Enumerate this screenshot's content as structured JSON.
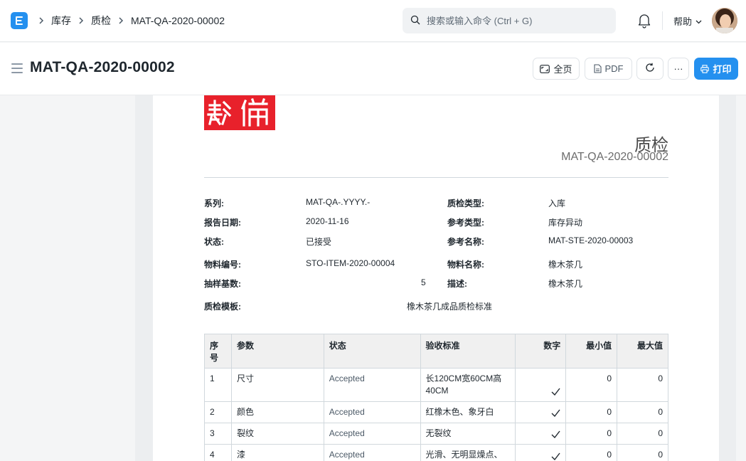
{
  "navbar": {
    "breadcrumbs": [
      "库存",
      "质检",
      "MAT-QA-2020-00002"
    ],
    "search_placeholder": "搜索或输入命令 (Ctrl + G)",
    "help_label": "帮助"
  },
  "page": {
    "title": "MAT-QA-2020-00002",
    "buttons": {
      "full_page": "全页",
      "pdf": "PDF",
      "more": "···",
      "print": "打印"
    }
  },
  "document": {
    "doctype_heading": "质检",
    "doc_name": "MAT-QA-2020-00002",
    "fields": {
      "series_label": "系列:",
      "series_value": "MAT-QA-.YYYY.-",
      "inspection_type_label": "质检类型:",
      "inspection_type_value": "入库",
      "report_date_label": "报告日期:",
      "report_date_value": "2020-11-16",
      "reference_type_label": "参考类型:",
      "reference_type_value": "库存异动",
      "status_label": "状态:",
      "status_value": "已接受",
      "reference_name_label": "参考名称:",
      "reference_name_value": "MAT-STE-2020-00003",
      "item_code_label": "物料编号:",
      "item_code_value": "STO-ITEM-2020-00004",
      "item_name_label": "物料名称:",
      "item_name_value": "橡木茶几",
      "sample_size_label": "抽样基数:",
      "sample_size_value": "5",
      "description_label": "描述:",
      "description_value": "橡木茶几",
      "template_label": "质检模板:",
      "template_value": "橡木茶几成品质检标准"
    },
    "table": {
      "headers": [
        "序号",
        "参数",
        "状态",
        "验收标准",
        "数字",
        "最小值",
        "最大值"
      ],
      "rows": [
        {
          "idx": "1",
          "param": "尺寸",
          "status": "Accepted",
          "criteria": "长120CM宽60CM高40CM",
          "numeric": true,
          "min": "0",
          "max": "0"
        },
        {
          "idx": "2",
          "param": "颜色",
          "status": "Accepted",
          "criteria": "红橡木色、象牙白",
          "numeric": true,
          "min": "0",
          "max": "0"
        },
        {
          "idx": "3",
          "param": "裂纹",
          "status": "Accepted",
          "criteria": "无裂纹",
          "numeric": true,
          "min": "0",
          "max": "0"
        },
        {
          "idx": "4",
          "param": "漆",
          "status": "Accepted",
          "criteria": "光滑、无明显燥点、颜色一致无明显色差",
          "numeric": true,
          "min": "0",
          "max": "0"
        }
      ]
    }
  },
  "colors": {
    "primary": "#2490ef",
    "brand_red": "#e8212b"
  }
}
